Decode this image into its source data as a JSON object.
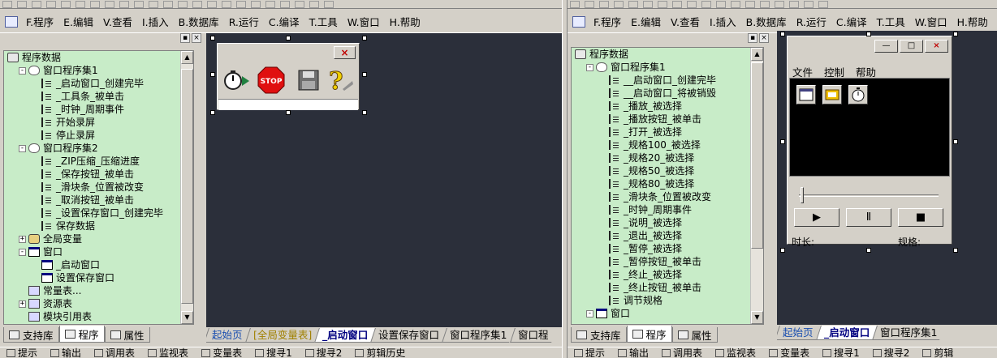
{
  "menu": [
    "F.程序",
    "E.编辑",
    "V.查看",
    "I.插入",
    "B.数据库",
    "R.运行",
    "C.编译",
    "T.工具",
    "W.窗口",
    "H.帮助"
  ],
  "left": {
    "tree": [
      {
        "depth": 0,
        "icon": "db",
        "toggle": "",
        "label": "程序数据"
      },
      {
        "depth": 1,
        "icon": "prog",
        "toggle": "-",
        "label": "窗口程序集1"
      },
      {
        "depth": 2,
        "icon": "sub",
        "toggle": "",
        "label": "_启动窗口_创建完毕"
      },
      {
        "depth": 2,
        "icon": "sub",
        "toggle": "",
        "label": "_工具条_被单击"
      },
      {
        "depth": 2,
        "icon": "sub",
        "toggle": "",
        "label": "_时钟_周期事件"
      },
      {
        "depth": 2,
        "icon": "sub",
        "toggle": "",
        "label": "开始录屏"
      },
      {
        "depth": 2,
        "icon": "sub",
        "toggle": "",
        "label": "停止录屏"
      },
      {
        "depth": 1,
        "icon": "prog",
        "toggle": "-",
        "label": "窗口程序集2"
      },
      {
        "depth": 2,
        "icon": "sub",
        "toggle": "",
        "label": "_ZIP压缩_压缩进度"
      },
      {
        "depth": 2,
        "icon": "sub",
        "toggle": "",
        "label": "_保存按钮_被单击"
      },
      {
        "depth": 2,
        "icon": "sub",
        "toggle": "",
        "label": "_滑块条_位置被改变"
      },
      {
        "depth": 2,
        "icon": "sub",
        "toggle": "",
        "label": "_取消按钮_被单击"
      },
      {
        "depth": 2,
        "icon": "sub",
        "toggle": "",
        "label": "_设置保存窗口_创建完毕"
      },
      {
        "depth": 2,
        "icon": "sub",
        "toggle": "",
        "label": "保存数据"
      },
      {
        "depth": 1,
        "icon": "can",
        "toggle": "+",
        "label": "全局变量"
      },
      {
        "depth": 1,
        "icon": "win",
        "toggle": "-",
        "label": "窗口"
      },
      {
        "depth": 2,
        "icon": "win",
        "toggle": "",
        "label": "_启动窗口"
      },
      {
        "depth": 2,
        "icon": "win",
        "toggle": "",
        "label": "设置保存窗口"
      },
      {
        "depth": 1,
        "icon": "misc",
        "toggle": "",
        "label": "常量表..."
      },
      {
        "depth": 1,
        "icon": "misc",
        "toggle": "+",
        "label": "资源表"
      },
      {
        "depth": 1,
        "icon": "misc",
        "toggle": "",
        "label": "模块引用表"
      }
    ],
    "bottom_tabs": [
      {
        "label": "支持库",
        "active": false
      },
      {
        "label": "程序",
        "active": true
      },
      {
        "label": "属性",
        "active": false
      }
    ],
    "doc_tabs": [
      {
        "label": "起始页",
        "style": "blue"
      },
      {
        "label": "[全局变量表]",
        "style": "gold"
      },
      {
        "label": "_启动窗口",
        "style": "active"
      },
      {
        "label": "设置保存窗口",
        "style": ""
      },
      {
        "label": "窗口程序集1",
        "style": ""
      },
      {
        "label": "窗口程",
        "style": ""
      }
    ],
    "status": [
      "提示",
      "输出",
      "调用表",
      "监视表",
      "变量表",
      "搜寻1",
      "搜寻2",
      "剪辑历史"
    ]
  },
  "right": {
    "tree": [
      {
        "depth": 0,
        "icon": "db",
        "toggle": "",
        "label": "程序数据"
      },
      {
        "depth": 1,
        "icon": "prog",
        "toggle": "-",
        "label": "窗口程序集1"
      },
      {
        "depth": 2,
        "icon": "sub",
        "toggle": "",
        "label": "__启动窗口_创建完毕"
      },
      {
        "depth": 2,
        "icon": "sub",
        "toggle": "",
        "label": "__启动窗口_将被销毁"
      },
      {
        "depth": 2,
        "icon": "sub",
        "toggle": "",
        "label": "_播放_被选择"
      },
      {
        "depth": 2,
        "icon": "sub",
        "toggle": "",
        "label": "_播放按钮_被单击"
      },
      {
        "depth": 2,
        "icon": "sub",
        "toggle": "",
        "label": "_打开_被选择"
      },
      {
        "depth": 2,
        "icon": "sub",
        "toggle": "",
        "label": "_规格100_被选择"
      },
      {
        "depth": 2,
        "icon": "sub",
        "toggle": "",
        "label": "_规格20_被选择"
      },
      {
        "depth": 2,
        "icon": "sub",
        "toggle": "",
        "label": "_规格50_被选择"
      },
      {
        "depth": 2,
        "icon": "sub",
        "toggle": "",
        "label": "_规格80_被选择"
      },
      {
        "depth": 2,
        "icon": "sub",
        "toggle": "",
        "label": "_滑块条_位置被改变"
      },
      {
        "depth": 2,
        "icon": "sub",
        "toggle": "",
        "label": "_时钟_周期事件"
      },
      {
        "depth": 2,
        "icon": "sub",
        "toggle": "",
        "label": "_说明_被选择"
      },
      {
        "depth": 2,
        "icon": "sub",
        "toggle": "",
        "label": "_退出_被选择"
      },
      {
        "depth": 2,
        "icon": "sub",
        "toggle": "",
        "label": "_暂停_被选择"
      },
      {
        "depth": 2,
        "icon": "sub",
        "toggle": "",
        "label": "_暂停按钮_被单击"
      },
      {
        "depth": 2,
        "icon": "sub",
        "toggle": "",
        "label": "_终止_被选择"
      },
      {
        "depth": 2,
        "icon": "sub",
        "toggle": "",
        "label": "_终止按钮_被单击"
      },
      {
        "depth": 2,
        "icon": "sub",
        "toggle": "",
        "label": "调节规格"
      },
      {
        "depth": 1,
        "icon": "win",
        "toggle": "-",
        "label": "窗口"
      }
    ],
    "bottom_tabs": [
      {
        "label": "支持库",
        "active": false
      },
      {
        "label": "程序",
        "active": true
      },
      {
        "label": "属性",
        "active": false
      }
    ],
    "doc_tabs": [
      {
        "label": "起始页",
        "style": "blue"
      },
      {
        "label": "_启动窗口",
        "style": "active"
      },
      {
        "label": "窗口程序集1",
        "style": ""
      }
    ],
    "status": [
      "提示",
      "输出",
      "调用表",
      "监视表",
      "变量表",
      "搜寻1",
      "搜寻2",
      "剪辑"
    ],
    "media": {
      "menu": [
        "文件",
        "控制",
        "帮助"
      ],
      "play": "▶",
      "pause": "Ⅱ",
      "stop": "■",
      "duration_label": "时长:",
      "spec_label": "规格:"
    }
  },
  "colors": {
    "tree_bg": "#c8ecc8",
    "designer_bg": "#2b2f3a",
    "active_tab": "#000080"
  }
}
